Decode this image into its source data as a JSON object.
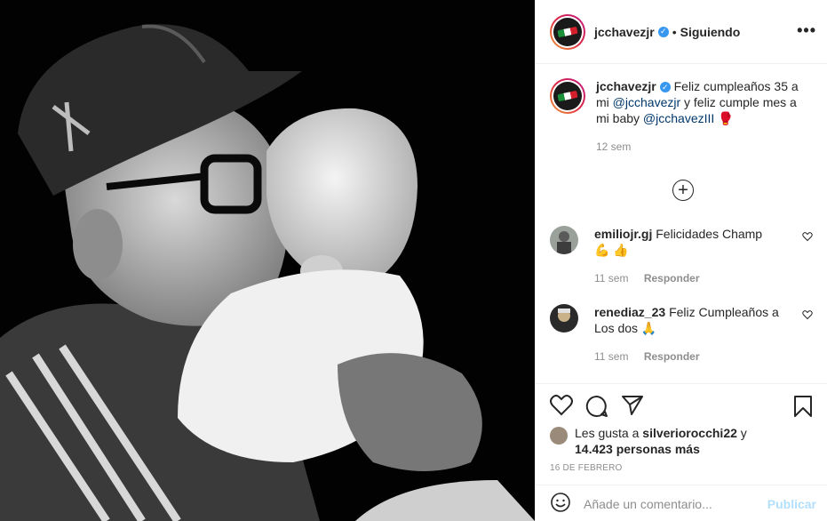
{
  "header": {
    "username": "jcchavezjr",
    "verified_mark": "✓",
    "separator": "•",
    "follow_status": "Siguiendo",
    "more_label": "•••"
  },
  "caption": {
    "username": "jcchavezjr",
    "text_1": "Feliz cumpleaños 35 a mi",
    "mention_1": "@jcchavezjr",
    "text_2": "y feliz cumple mes a mi baby",
    "mention_2": "@jcchavezIII",
    "emoji": "🥊",
    "time": "12 sem"
  },
  "load_more": "+",
  "comments": [
    {
      "username": "emiliojr.gj",
      "text": "Felicidades Champ 💪 👍",
      "time": "11 sem",
      "reply_label": "Responder"
    },
    {
      "username": "renediaz_23",
      "text": "Feliz Cumpleaños a Los dos 🙏",
      "time": "11 sem",
      "reply_label": "Responder"
    }
  ],
  "likes": {
    "prefix": "Les gusta a",
    "user": "silveriorocchi22",
    "connector": "y",
    "count": "14.423 personas más"
  },
  "date": "16 DE FEBRERO",
  "add_comment": {
    "placeholder": "Añade un comentario...",
    "publish_label": "Publicar"
  },
  "colors": {
    "link": "#00376b",
    "verified": "#3897f0",
    "publish_disabled": "#b2dffc",
    "muted": "#8e8e8e"
  }
}
